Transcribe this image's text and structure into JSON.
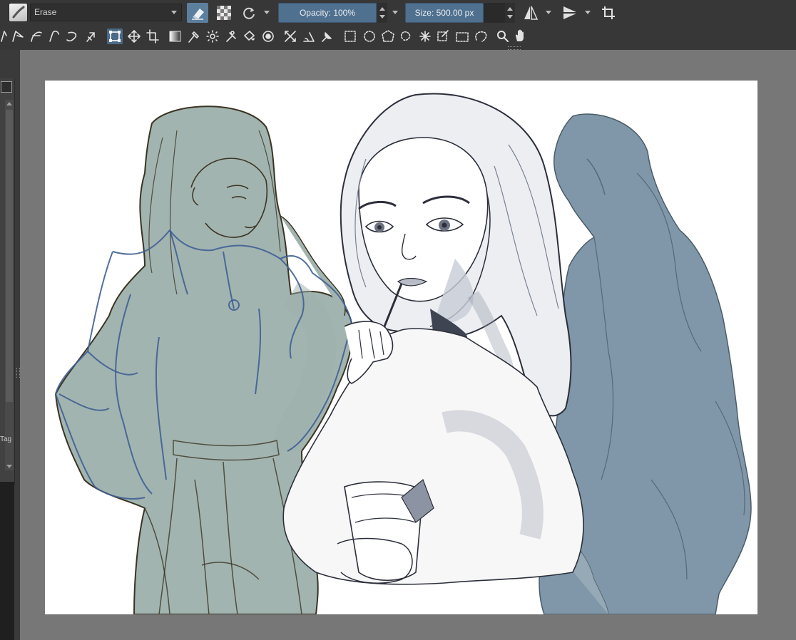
{
  "tool_options": {
    "brush_preset": "Erase",
    "opacity_label": "Opacity: 100%",
    "size_label": "Size: 500.00 px",
    "eraser_mode_active": true,
    "accent_color": "#5d7f9e"
  },
  "toolbox": {
    "tools": [
      "path-icon",
      "polyline-icon",
      "bezier-curve-icon",
      "freehand-path-icon",
      "dynamic-brush-icon",
      "multibrush-icon",
      "transform-icon",
      "move-icon",
      "crop-icon",
      "gradient-icon",
      "color-picker-icon",
      "smart-patch-icon",
      "assistant-icon",
      "fill-icon",
      "enclosed-fill-icon",
      "measure-icon",
      "angle-icon",
      "reference-pin-icon",
      "rect-select-icon",
      "ellipse-select-icon",
      "polygon-select-icon",
      "freehand-select-icon",
      "contiguous-select-icon",
      "similar-select-icon",
      "bezier-select-icon",
      "magnetic-select-icon",
      "zoom-icon",
      "pan-icon"
    ],
    "active_tool": "transform-icon"
  },
  "docker": {
    "tag_label": "Tag"
  },
  "canvas": {
    "background": "#ffffff",
    "figure_left_color": "#a2b4b0",
    "figure_right_color": "#7f97a8",
    "sketch_stroke_color": "#2c2f3a",
    "blue_sketch_color": "#3f5f93"
  }
}
